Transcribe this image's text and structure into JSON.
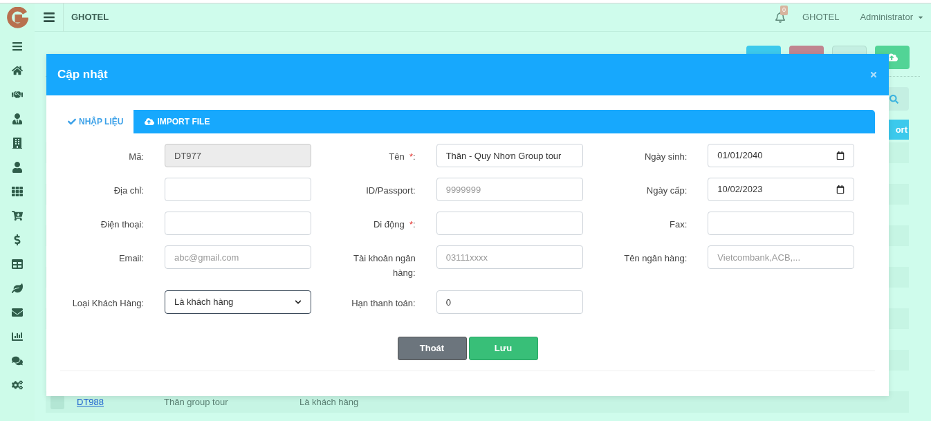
{
  "topbar": {
    "brand": "GHOTEL",
    "notification_count": "0",
    "hotel": "GHOTEL",
    "user": "Administrator"
  },
  "background_page": {
    "export_button": "ort",
    "table_rows": [
      {
        "code": "DT988",
        "name": "Thân group tour",
        "type": "Là khách hàng",
        "checked": false
      }
    ]
  },
  "modal": {
    "title": "Cập nhật",
    "tabs": [
      {
        "label": "NHẬP LIỆU",
        "selected": true
      },
      {
        "label": "IMPORT FILE",
        "selected": false
      }
    ],
    "fields": [
      {
        "label": "Mã:",
        "kind": "text",
        "value": "DT977",
        "disabled": true,
        "required": false
      },
      {
        "label": "Tên",
        "kind": "text",
        "value": "Thân - Quy Nhơn Group tour",
        "disabled": false,
        "required": true
      },
      {
        "label": "Ngày sinh:",
        "kind": "date",
        "value": "01/01/2040",
        "disabled": false,
        "required": false
      },
      {
        "label": "Địa chỉ:",
        "kind": "text",
        "disabled": false,
        "required": false
      },
      {
        "label": "ID/Passport:",
        "kind": "text",
        "placeholder": "9999999",
        "disabled": false,
        "required": false
      },
      {
        "label": "Ngày cấp:",
        "kind": "date",
        "value": "10/02/2023",
        "disabled": false,
        "required": false
      },
      {
        "label": "Điện thoại:",
        "kind": "text",
        "disabled": false,
        "required": false
      },
      {
        "label": "Di động",
        "kind": "text",
        "disabled": false,
        "required": true
      },
      {
        "label": "Fax:",
        "kind": "text",
        "disabled": false,
        "required": false
      },
      {
        "label": "Email:",
        "kind": "text",
        "placeholder": "abc@gmail.com",
        "disabled": false,
        "required": false
      },
      {
        "label": "Tài khoản ngân hàng:",
        "kind": "text",
        "placeholder": "03111xxxx",
        "disabled": false,
        "required": false
      },
      {
        "label": "Tên ngân hàng:",
        "kind": "text",
        "placeholder": "Vietcombank,ACB,...",
        "disabled": false,
        "required": false
      },
      {
        "label": "Loại Khách Hàng:",
        "kind": "select",
        "value": "Là khách hàng",
        "disabled": false,
        "required": false
      },
      {
        "label": "Hạn thanh toán:",
        "kind": "text",
        "value": "0",
        "disabled": false,
        "required": false
      }
    ],
    "required_mark": "*",
    "required_suffix": ":",
    "buttons": [
      {
        "label": "Thoát",
        "kind": "secondary"
      },
      {
        "label": "Lưu",
        "kind": "primary"
      }
    ]
  }
}
